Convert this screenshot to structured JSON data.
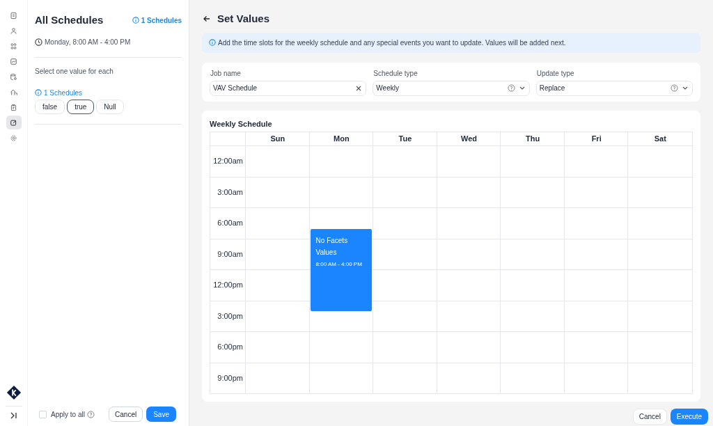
{
  "nav": [
    {
      "selected": false
    },
    {
      "selected": false
    },
    {
      "selected": false
    },
    {
      "selected": false
    },
    {
      "selected": false
    },
    {
      "selected": false
    },
    {
      "selected": false
    },
    {
      "selected": true
    },
    {
      "selected": false
    }
  ],
  "panel": {
    "title": "All Schedules",
    "count": "1 Schedules",
    "time": "Monday, 8:00 AM - 4:00 PM",
    "instruction": "Select one value for each",
    "group_count": "1 Schedules",
    "options": [
      {
        "label": "false",
        "selected": false
      },
      {
        "label": "true",
        "selected": true
      },
      {
        "label": "Null",
        "selected": false
      }
    ],
    "apply_to_all": {
      "label": "Apply to all",
      "checked": false
    },
    "buttons": [
      "Cancel",
      "Save"
    ]
  },
  "page": {
    "title": "Set Values",
    "info": "Add the time slots for the weekly schedule and any special events you want to update. Values will be added next.",
    "fields": [
      {
        "label": "Job name",
        "value": "VAV Schedule",
        "kind": "text"
      },
      {
        "label": "Schedule type",
        "value": "Weekly",
        "kind": "select"
      },
      {
        "label": "Update type",
        "value": "Replace",
        "kind": "select"
      }
    ],
    "schedule": {
      "title": "Weekly Schedule",
      "times": [
        "12:00am",
        "3:00am",
        "6:00am",
        "9:00am",
        "12:00pm",
        "3:00pm",
        "6:00pm",
        "9:00pm"
      ],
      "days": [
        {
          "label": "Sun"
        },
        {
          "label": "Mon",
          "events": [
            {
              "title": "No Facets Values",
              "time": "8:00 AM - 4:00 PM"
            }
          ]
        },
        {
          "label": "Tue"
        },
        {
          "label": "Wed"
        },
        {
          "label": "Thu"
        },
        {
          "label": "Fri"
        },
        {
          "label": "Sat"
        }
      ]
    },
    "buttons": [
      "Cancel",
      "Execute"
    ]
  }
}
